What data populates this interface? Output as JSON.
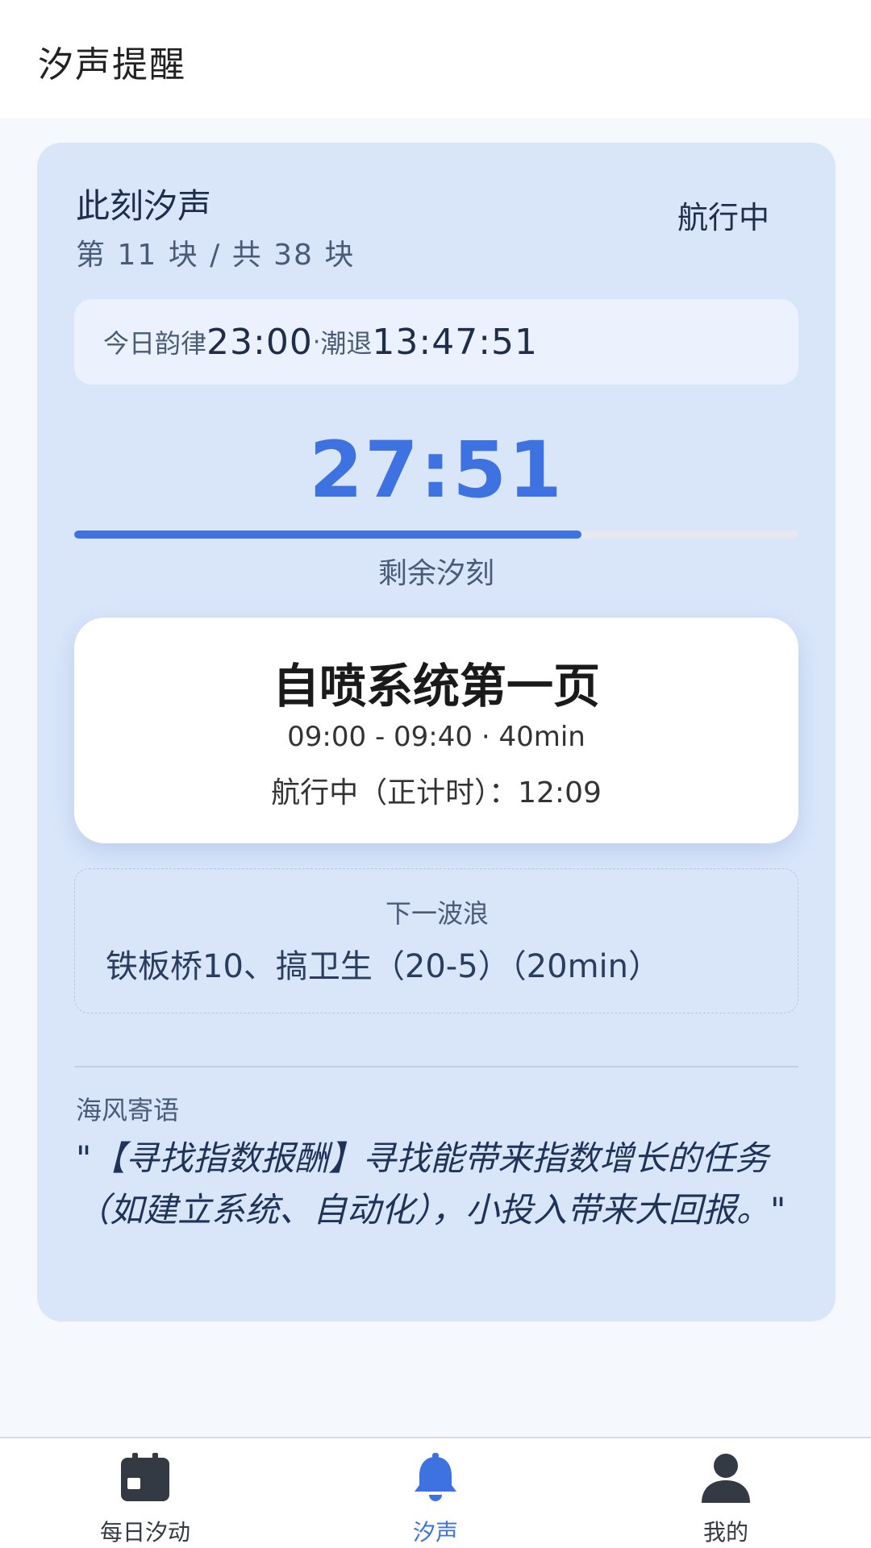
{
  "header": {
    "title": "汐声提醒"
  },
  "card": {
    "title": "此刻汐声",
    "subtitle": "第 11 块 / 共 38 块",
    "status": "航行中"
  },
  "rhythm": {
    "label1": "今日韵律",
    "value1": "23:00",
    "separator": "·",
    "label2": "潮退",
    "value2": "13:47:51"
  },
  "countdown": {
    "value": "27:51",
    "label": "剩余汐刻",
    "progress_fraction": 0.7
  },
  "task": {
    "title": "自喷系统第一页",
    "time": "09:00 - 09:40 · 40min",
    "elapsed": "航行中（正计时）：12:09"
  },
  "next": {
    "label": "下一波浪",
    "text": "铁板桥10、搞卫生（20-5）（20min）"
  },
  "quote": {
    "label": "海风寄语",
    "text": "\"【寻找指数报酬】寻找能带来指数增长的任务（如建立系统、自动化），小投入带来大回报。\""
  },
  "nav": {
    "items": [
      {
        "label": "每日汐动",
        "icon": "calendar-icon"
      },
      {
        "label": "汐声",
        "icon": "bell-icon",
        "active": true
      },
      {
        "label": "我的",
        "icon": "person-icon"
      }
    ]
  },
  "colors": {
    "accent": "#3d72e0",
    "card_bg": "#d9e6fa",
    "nav_inactive": "#333a44"
  }
}
